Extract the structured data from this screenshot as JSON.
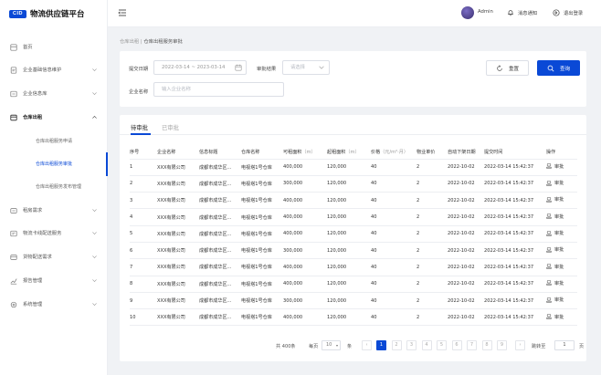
{
  "brand": {
    "mark": "CID",
    "name": "物流供应链平台",
    "color": "#0a49d6"
  },
  "sidebar": {
    "items": [
      {
        "label": "首页",
        "icon": "home-icon",
        "expandable": false
      },
      {
        "label": "企业基础信息维护",
        "icon": "document-icon",
        "expandable": true
      },
      {
        "label": "企业信息库",
        "icon": "database-icon",
        "expandable": true
      },
      {
        "label": "仓库出租",
        "icon": "warehouse-icon",
        "expandable": true,
        "expanded": true
      },
      {
        "label": "租房需求",
        "icon": "demand-icon",
        "expandable": true
      },
      {
        "label": "物流卡线配送服务",
        "icon": "delivery-icon",
        "expandable": true
      },
      {
        "label": "货物配送需求",
        "icon": "cargo-icon",
        "expandable": true
      },
      {
        "label": "报告管理",
        "icon": "report-icon",
        "expandable": true
      },
      {
        "label": "系统管理",
        "icon": "settings-icon",
        "expandable": true
      }
    ],
    "subitems": [
      {
        "label": "仓库出租服务申请",
        "active": false
      },
      {
        "label": "仓库出租服务审批",
        "active": true
      },
      {
        "label": "仓库出租服务发布管理",
        "active": false
      }
    ]
  },
  "header": {
    "user": "Admin",
    "notify": "消息通知",
    "logout": "退出登录"
  },
  "breadcrumb": {
    "parent": "仓库出租",
    "sep": " | ",
    "current": "仓库出租服务审批"
  },
  "filter": {
    "date_label": "提交日期",
    "date_value": "2022-03-14 ~ 2023-03-14",
    "result_label": "审批结果",
    "result_placeholder": "请选择",
    "company_label": "企业名称",
    "company_placeholder": "输入企业名称",
    "reset": "重置",
    "query": "查询"
  },
  "tabs": [
    {
      "label": "待审批",
      "active": true
    },
    {
      "label": "已审批",
      "active": false
    }
  ],
  "table": {
    "headers": [
      {
        "label": "序号",
        "unit": ""
      },
      {
        "label": "企业名称",
        "unit": ""
      },
      {
        "label": "信息标题",
        "unit": ""
      },
      {
        "label": "仓库名称",
        "unit": ""
      },
      {
        "label": "可租面积",
        "unit": "（m）"
      },
      {
        "label": "起租面积",
        "unit": "（m）"
      },
      {
        "label": "价格",
        "unit": "（元/m²·月）"
      },
      {
        "label": "物业单价",
        "unit": ""
      },
      {
        "label": "自动下架日期",
        "unit": ""
      },
      {
        "label": "提交时间",
        "unit": ""
      },
      {
        "label": "操作",
        "unit": ""
      }
    ],
    "rows": [
      [
        "1",
        "XXX有限公司",
        "成都市成华区...",
        "电视塔1号仓库",
        "400,000",
        "120,000",
        "40",
        "2",
        "2022-10-02",
        "2022-03-14 15:42:37",
        "审批"
      ],
      [
        "2",
        "XXX有限公司",
        "成都市成华区...",
        "电视塔1号仓库",
        "300,000",
        "120,000",
        "40",
        "2",
        "2022-10-02",
        "2022-03-14 15:42:37",
        "审批"
      ],
      [
        "3",
        "XXX有限公司",
        "成都市成华区...",
        "电视塔1号仓库",
        "400,000",
        "120,000",
        "40",
        "2",
        "2022-10-02",
        "2022-03-14 15:42:37",
        "审批"
      ],
      [
        "4",
        "XXX有限公司",
        "成都市成华区...",
        "电视塔1号仓库",
        "400,000",
        "120,000",
        "40",
        "2",
        "2022-10-02",
        "2022-03-14 15:42:37",
        "审批"
      ],
      [
        "5",
        "XXX有限公司",
        "成都市成华区...",
        "电视塔1号仓库",
        "400,000",
        "120,000",
        "40",
        "2",
        "2022-10-02",
        "2022-03-14 15:42:37",
        "审批"
      ],
      [
        "6",
        "XXX有限公司",
        "成都市成华区...",
        "电视塔1号仓库",
        "300,000",
        "120,000",
        "40",
        "2",
        "2022-10-02",
        "2022-03-14 15:42:37",
        "审批"
      ],
      [
        "7",
        "XXX有限公司",
        "成都市成华区...",
        "电视塔1号仓库",
        "400,000",
        "120,000",
        "40",
        "2",
        "2022-10-02",
        "2022-03-14 15:42:37",
        "审批"
      ],
      [
        "8",
        "XXX有限公司",
        "成都市成华区...",
        "电视塔1号仓库",
        "400,000",
        "120,000",
        "40",
        "2",
        "2022-10-02",
        "2022-03-14 15:42:37",
        "审批"
      ],
      [
        "9",
        "XXX有限公司",
        "成都市成华区...",
        "电视塔1号仓库",
        "300,000",
        "120,000",
        "40",
        "2",
        "2022-10-02",
        "2022-03-14 15:42:37",
        "审批"
      ],
      [
        "10",
        "XXX有限公司",
        "成都市成华区...",
        "电视塔1号仓库",
        "400,000",
        "120,000",
        "40",
        "2",
        "2022-10-02",
        "2022-03-14 15:42:37",
        "审批"
      ]
    ]
  },
  "pagination": {
    "total": "共 400条",
    "per_page_label": "每页",
    "per_page_value": "10",
    "per_page_unit": "条",
    "prev": "‹",
    "pages": [
      "1",
      "2",
      "3",
      "4",
      "5",
      "6",
      "7",
      "8",
      "9"
    ],
    "current_page": "1",
    "next": "›",
    "goto_label": "跳转至",
    "goto_value": "1",
    "goto_unit": "页"
  }
}
